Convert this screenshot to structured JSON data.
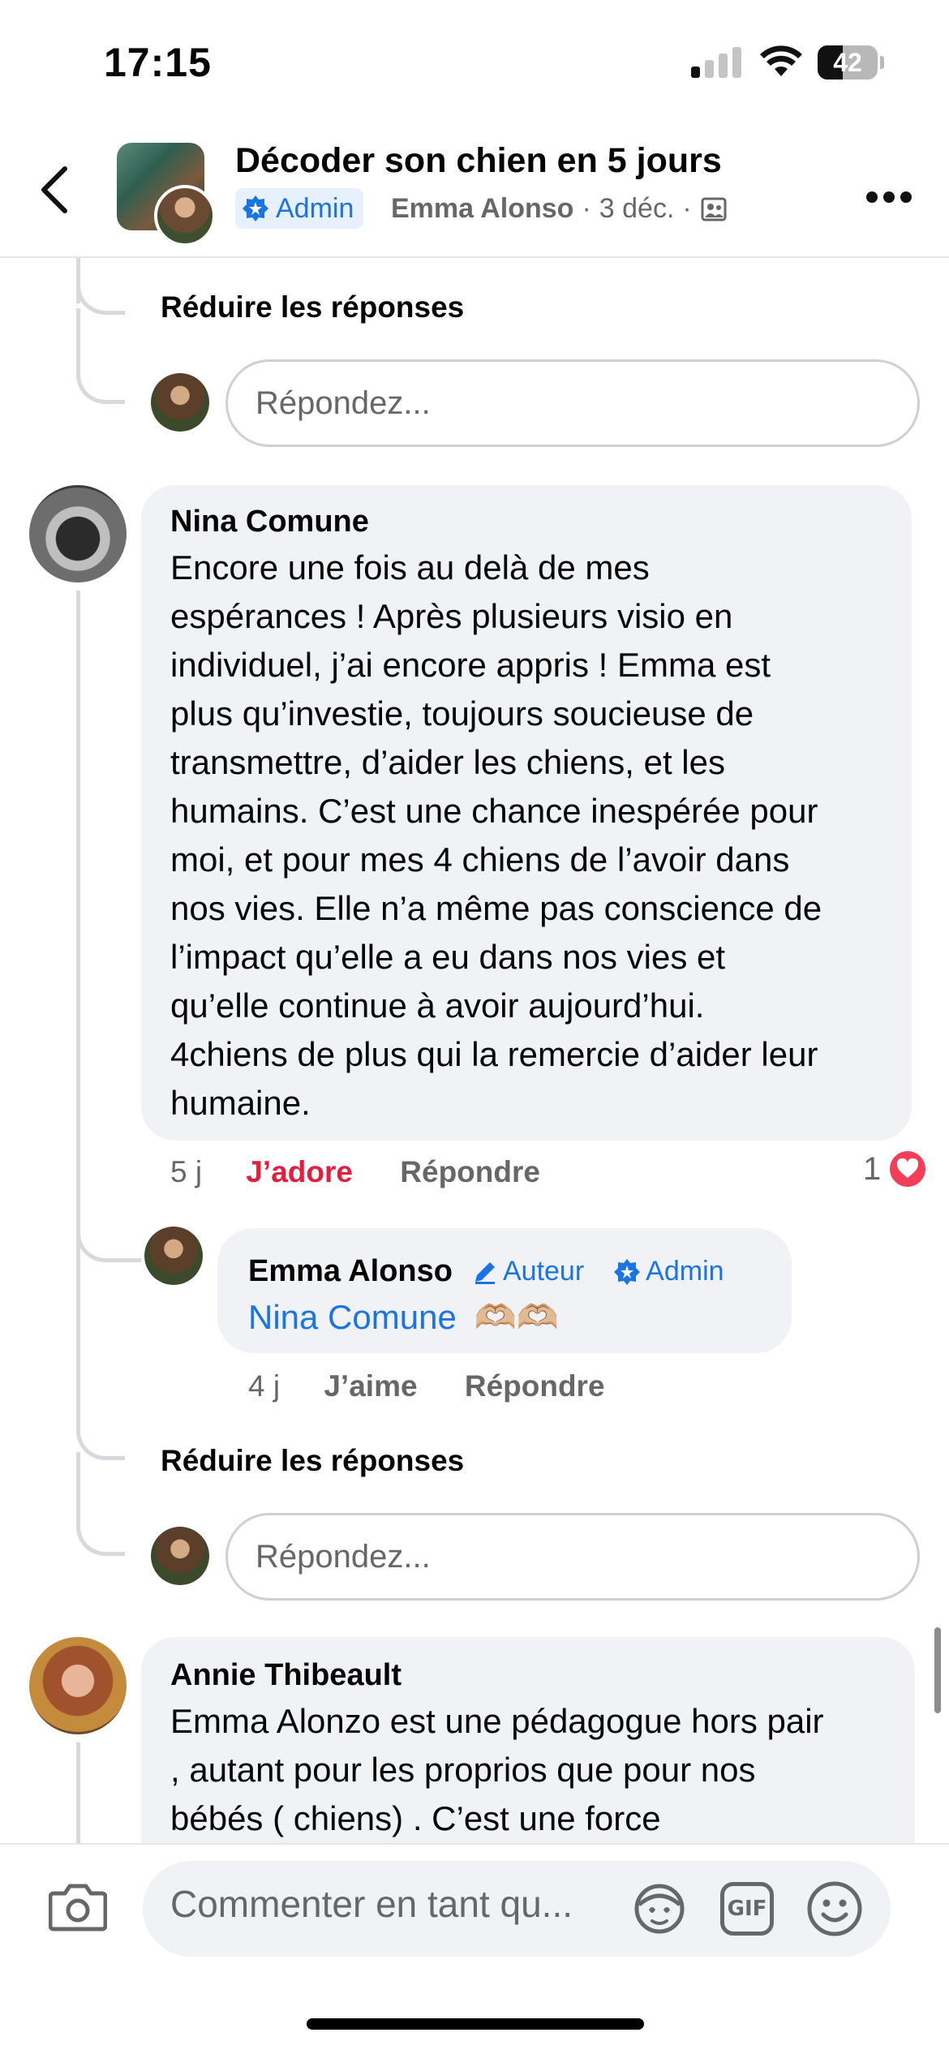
{
  "status_bar": {
    "time": "17:15",
    "battery": "42"
  },
  "header": {
    "title": "Décoder son chien en 5 jours",
    "admin_label": "Admin",
    "author": "Emma Alonso",
    "date": "3 déc.",
    "sep": "·"
  },
  "thread_top": {
    "reduce_label": "Réduire les réponses",
    "reply_placeholder": "Répondez..."
  },
  "comment_nina": {
    "name": "Nina Comune",
    "lines": [
      "Encore une fois au delà de mes",
      "espérances ! Après plusieurs visio en",
      "individuel, j’ai encore appris ! Emma est",
      "plus qu’investie, toujours soucieuse de",
      "transmettre, d’aider les chiens, et les",
      "humains. C’est une chance inespérée pour",
      "moi, et pour mes 4 chiens de l’avoir dans",
      "nos vies. Elle n’a même pas conscience de",
      "l’impact qu’elle a eu dans nos vies et",
      "qu’elle continue à avoir aujourd’hui.",
      "4chiens de plus qui la remercie d’aider leur",
      "humaine."
    ],
    "time": "5 j",
    "reaction_action": "J’adore",
    "reply_action": "Répondre",
    "reaction_count": "1"
  },
  "reply_emma": {
    "name": "Emma Alonso",
    "author_tag": "Auteur",
    "admin_tag": "Admin",
    "mention": "Nina Comune",
    "emoji": "🫶🏼🫶🏼",
    "time": "4 j",
    "like_action": "J’aime",
    "reply_action": "Répondre"
  },
  "thread_bottom": {
    "reduce_label": "Réduire les réponses",
    "reply_placeholder": "Répondez..."
  },
  "comment_annie": {
    "name": "Annie Thibeault",
    "lines": [
      "Emma Alonzo est une pédagogue hors pair",
      ", autant pour les proprios que pour nos",
      "bébés ( chiens) . C’est une force"
    ]
  },
  "composer": {
    "placeholder": "Commenter en tant qu...",
    "gif_label": "GIF"
  },
  "colors": {
    "accent_blue": "#1b74e4",
    "love_red": "#e41e3f",
    "bubble_gray": "#f0f2f5",
    "secondary_text": "#65676b"
  },
  "icons": [
    "back-chevron-icon",
    "admin-star-icon",
    "group-privacy-icon",
    "more-icon",
    "heart-icon",
    "edit-pencil-icon",
    "camera-icon",
    "avatar-sticker-icon",
    "gif-icon",
    "emoji-icon"
  ]
}
